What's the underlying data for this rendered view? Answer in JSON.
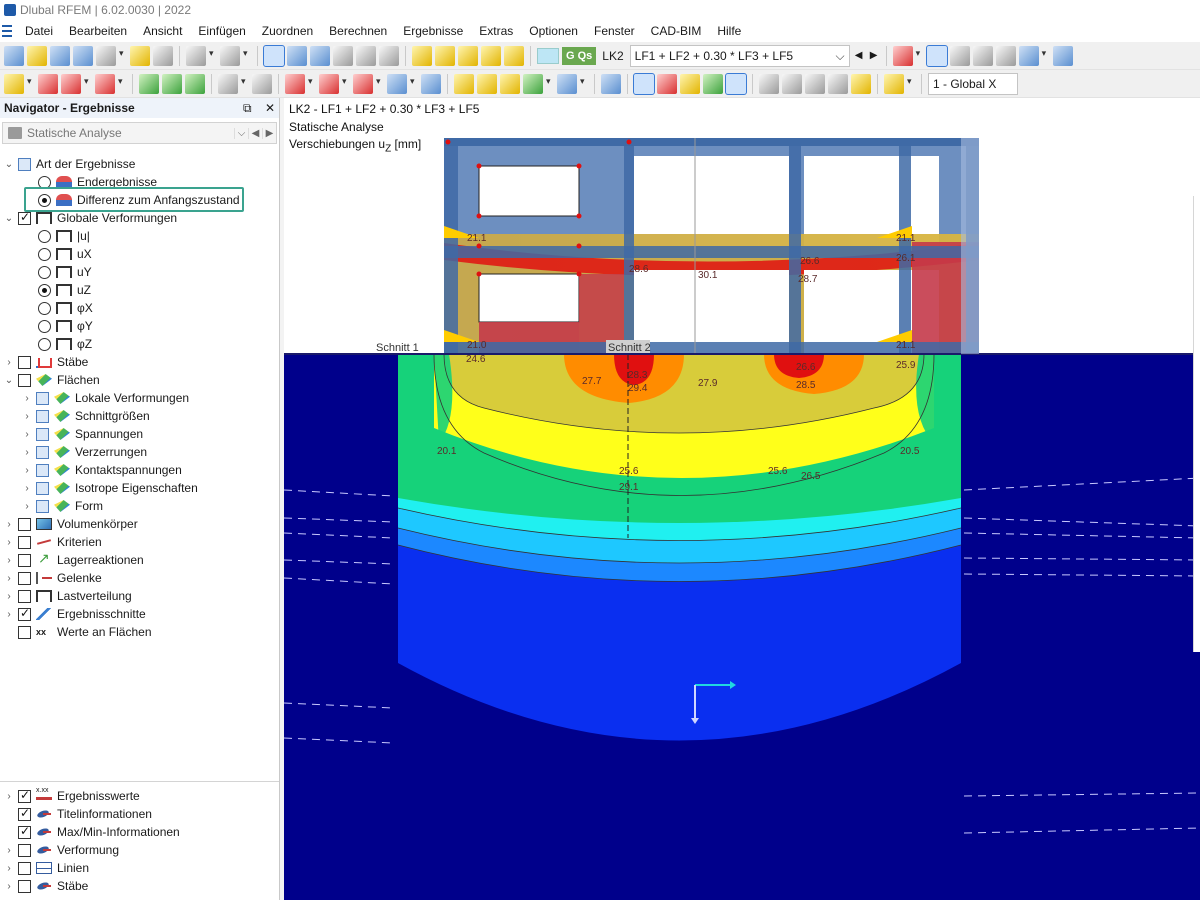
{
  "window": {
    "title": "Dlubal RFEM | 6.02.0030 | 2022"
  },
  "menu": [
    "Datei",
    "Bearbeiten",
    "Ansicht",
    "Einfügen",
    "Zuordnen",
    "Berechnen",
    "Ergebnisse",
    "Extras",
    "Optionen",
    "Fenster",
    "CAD-BIM",
    "Hilfe"
  ],
  "toolbar": {
    "lc_tag": "G Qs",
    "lc_name": "LK2",
    "lc_combo": "LF1 + LF2 + 0.30 * LF3 + LF5",
    "view_combo": "1 - Global X",
    "result_values_icon": "x.xxx"
  },
  "navigator": {
    "title": "Navigator - Ergebnisse",
    "pin_icon": "pin-icon",
    "close_icon": "close-icon",
    "analysis_select": "Statische Analyse",
    "tree": [
      "Art der Ergebnisse",
      "Endergebnisse",
      "Differenz zum Anfangszustand",
      "Globale Verformungen",
      "|u|",
      "uX",
      "uY",
      "uZ",
      "φX",
      "φY",
      "φZ",
      "Stäbe",
      "Flächen",
      "Lokale Verformungen",
      "Schnittgrößen",
      "Spannungen",
      "Verzerrungen",
      "Kontaktspannungen",
      "Isotrope Eigenschaften",
      "Form",
      "Volumenkörper",
      "Kriterien",
      "Lagerreaktionen",
      "Gelenke",
      "Lastverteilung",
      "Ergebnisschnitte",
      "Werte an Flächen"
    ],
    "bottom_tree": [
      "Ergebnisswerte",
      "Titelinformationen",
      "Max/Min-Informationen",
      "Verformung",
      "Linien",
      "Stäbe"
    ]
  },
  "viewport": {
    "info_line1": "LK2 - LF1 + LF2 + 0.30 * LF3 + LF5",
    "info_line2": "Statische Analyse",
    "info_line3_prefix": "Verschiebungen u",
    "info_line3_sub": "Z",
    "info_line3_suffix": " [mm]",
    "section_labels": [
      "Schnitt 1",
      "Schnitt 2"
    ],
    "result_labels": [
      "21.1",
      "28.6",
      "30.1",
      "26.6",
      "28.7",
      "21.1",
      "26.1",
      "21.0",
      "21.1",
      "24.6",
      "27.7",
      "28.3",
      "29.4",
      "27.9",
      "26.6",
      "28.5",
      "25.9",
      "20.1",
      "25.6",
      "29.1",
      "25.6",
      "26.5",
      "20.5"
    ],
    "colors": {
      "background_blue": "#00008b",
      "mid_blue": "#0a2ff0",
      "cyan": "#1ec8ff",
      "green": "#16d27a",
      "yellow": "#ffff1a",
      "orange": "#ff8c00",
      "red": "#e01010"
    }
  }
}
